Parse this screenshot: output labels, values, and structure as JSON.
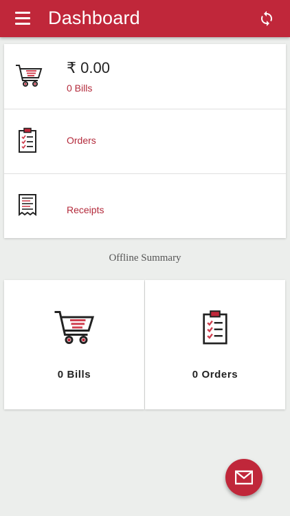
{
  "app": {
    "title": "Dashboard",
    "accent": "#c0273a",
    "icons": {
      "menu": "menu-icon",
      "refresh": "refresh-icon"
    }
  },
  "summary": {
    "amount": "₹ 0.00",
    "bills_label": "0 Bills",
    "orders_label": "Orders",
    "receipts_label": "Receipts",
    "icons": [
      "cart-icon",
      "clipboard-checklist-icon",
      "receipt-icon"
    ]
  },
  "offline": {
    "heading": "Offline Summary",
    "bills_label": "0 Bills",
    "orders_label": "0 Orders"
  },
  "fab": {
    "icon": "mail-icon"
  }
}
